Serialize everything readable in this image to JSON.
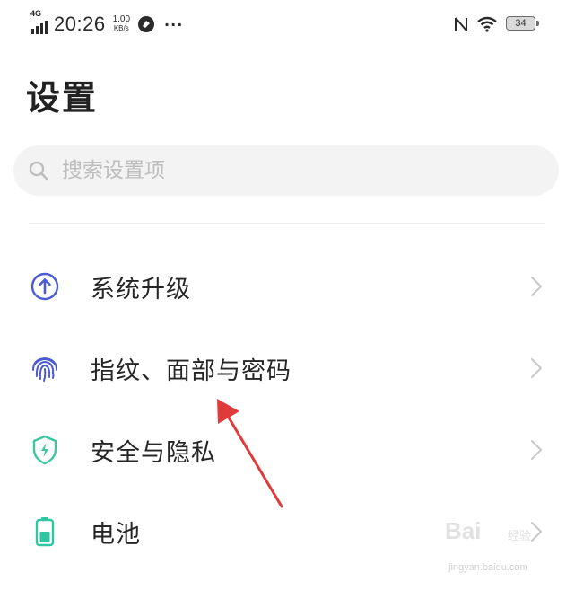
{
  "status_bar": {
    "network_type": "4G",
    "time": "20:26",
    "speed_value": "1.00",
    "speed_unit": "KB/s",
    "more": "···",
    "battery_level": "34"
  },
  "header": {
    "title": "设置"
  },
  "search": {
    "placeholder": "搜索设置项"
  },
  "settings": {
    "items": [
      {
        "label": "系统升级",
        "icon": "upload-arrow-icon"
      },
      {
        "label": "指纹、面部与密码",
        "icon": "fingerprint-icon"
      },
      {
        "label": "安全与隐私",
        "icon": "shield-icon"
      },
      {
        "label": "电池",
        "icon": "battery-icon"
      }
    ]
  },
  "colors": {
    "accent_blue": "#4a5bd4",
    "shield_green": "#3cc7a0",
    "battery_green": "#2fc6a2",
    "annotation_red": "#e03a3a"
  },
  "watermark": {
    "brand": "Bai",
    "sub": "经验",
    "url": "jingyan.baidu.com"
  }
}
